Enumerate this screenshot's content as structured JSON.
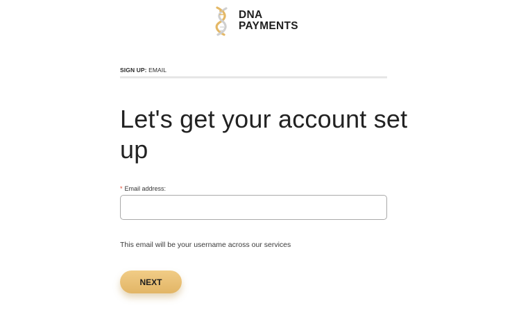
{
  "brand": {
    "line1": "DNA",
    "line2": "PAYMENTS",
    "accent_color": "#e2b566"
  },
  "step": {
    "key": "SIGN UP:",
    "value": "EMAIL"
  },
  "headline": "Let's get your account set up",
  "form": {
    "email": {
      "required_marker": "*",
      "label": "Email address:",
      "value": ""
    },
    "helper_text": "This email will be your username across our services",
    "submit_label": "NEXT"
  },
  "icons": {
    "logo": "dna-helix-icon"
  }
}
